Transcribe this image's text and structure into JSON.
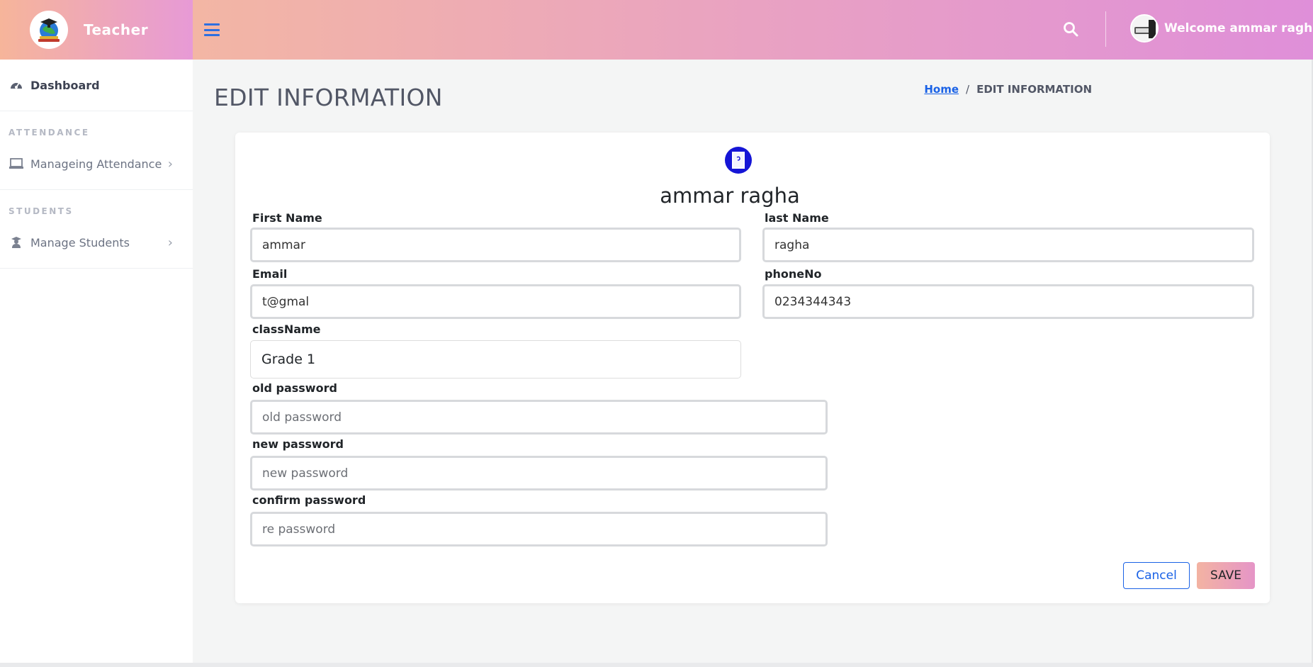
{
  "brand": {
    "name": "Teacher",
    "logo_icon": "school-globe-logo"
  },
  "topbar": {
    "welcome_text": "Welcome ammar ragha",
    "menu_icon": "hamburger-icon",
    "search_icon": "search-icon"
  },
  "sidebar": {
    "dashboard": {
      "label": "Dashboard",
      "icon": "dashboard-gauge-icon"
    },
    "sections": [
      {
        "title": "ATTENDANCE",
        "item": {
          "label": "Manageing Attendance",
          "icon": "laptop-icon"
        }
      },
      {
        "title": "STUDENTS",
        "item": {
          "label": "Manage Students",
          "icon": "user-graduate-icon"
        }
      }
    ]
  },
  "page": {
    "title": "EDIT INFORMATION",
    "breadcrumb": {
      "home": "Home",
      "separator": "/",
      "current": "EDIT INFORMATION"
    }
  },
  "form": {
    "profile_name": "ammar ragha",
    "first_name": {
      "label": "First Name",
      "value": "ammar"
    },
    "last_name": {
      "label": "last Name",
      "value": "ragha"
    },
    "email": {
      "label": "Email",
      "value": "t@gmal"
    },
    "phone": {
      "label": "phoneNo",
      "value": "0234344343"
    },
    "class_name": {
      "label": "className",
      "value": "Grade 1"
    },
    "old_password": {
      "label": "old password",
      "placeholder": "old password"
    },
    "new_password": {
      "label": "new password",
      "placeholder": "new password"
    },
    "confirm_password": {
      "label": "confirm password",
      "placeholder": "re password"
    },
    "cancel_label": "Cancel",
    "save_label": "SAVE"
  },
  "colors": {
    "accent_blue": "#1a62e6",
    "header_gradient_start": "#f3b6a4",
    "header_gradient_end": "#df8fd9",
    "profile_icon_blue": "#1515d6"
  }
}
